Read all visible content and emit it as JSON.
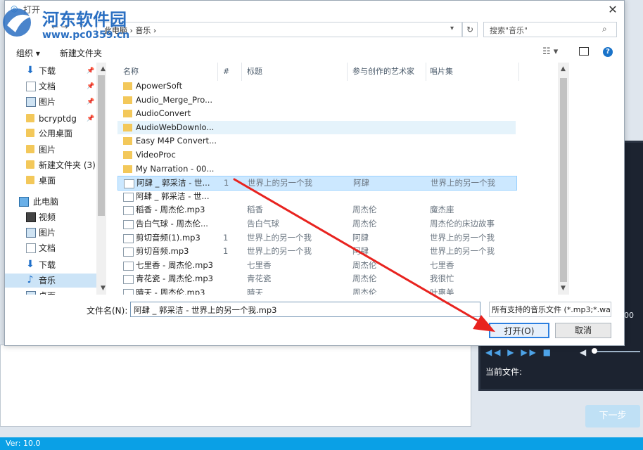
{
  "background": {
    "version": "Ver: 10.0",
    "next_button": "下一步",
    "current_file_label": "当前文件:",
    "time_fragment": "00"
  },
  "watermark": {
    "name": "河东软件园",
    "url": "www.pc0359.cn"
  },
  "dialog": {
    "title": "打开",
    "close": "✕",
    "breadcrumbs": "此电脑  ›  音乐  ›",
    "search_placeholder": "搜索\"音乐\"",
    "organize": "组织 ▾",
    "new_folder": "新建文件夹",
    "help": "?"
  },
  "nav": [
    {
      "label": "下载",
      "icon": "download-icon",
      "pinned": true
    },
    {
      "label": "文档",
      "icon": "document-icon",
      "pinned": true
    },
    {
      "label": "图片",
      "icon": "picture-icon",
      "pinned": true
    },
    {
      "label": "bcryptdg",
      "icon": "folder-icon",
      "pinned": true
    },
    {
      "label": "公用桌面",
      "icon": "folder-icon",
      "pinned": false
    },
    {
      "label": "图片",
      "icon": "folder-icon",
      "pinned": false
    },
    {
      "label": "新建文件夹 (3)",
      "icon": "folder-icon",
      "pinned": false
    },
    {
      "label": "桌面",
      "icon": "folder-icon",
      "pinned": false
    },
    {
      "label": "此电脑",
      "icon": "computer-icon",
      "pinned": false
    },
    {
      "label": "视频",
      "icon": "video-icon",
      "pinned": false
    },
    {
      "label": "图片",
      "icon": "picture-icon",
      "pinned": false
    },
    {
      "label": "文档",
      "icon": "document-icon",
      "pinned": false
    },
    {
      "label": "下载",
      "icon": "download-icon",
      "pinned": false
    },
    {
      "label": "音乐",
      "icon": "music-icon",
      "pinned": false,
      "selected": true
    },
    {
      "label": "桌面",
      "icon": "desktop-icon",
      "pinned": false
    }
  ],
  "columns": [
    "名称",
    "#",
    "标题",
    "参与创作的艺术家",
    "唱片集"
  ],
  "files": [
    {
      "name": "ApowerSoft",
      "type": "folder"
    },
    {
      "name": "Audio_Merge_Pro...",
      "type": "folder"
    },
    {
      "name": "AudioConvert",
      "type": "folder"
    },
    {
      "name": "AudioWebDownlo...",
      "type": "folder",
      "hover": true
    },
    {
      "name": "Easy M4P Convert...",
      "type": "folder"
    },
    {
      "name": "VideoProc",
      "type": "folder"
    },
    {
      "name": "My Narration - 00...",
      "type": "folder"
    },
    {
      "name": "阿肆 _ 郭采洁 - 世...",
      "type": "audio",
      "num": "1",
      "title": "世界上的另一个我",
      "artist": "阿肆",
      "album": "世界上的另一个我",
      "selected": true
    },
    {
      "name": "阿肆 _ 郭采洁 - 世...",
      "type": "audio"
    },
    {
      "name": "稻香 - 周杰伦.mp3",
      "type": "audio",
      "num": "",
      "title": "稻香",
      "artist": "周杰伦",
      "album": "魔杰座"
    },
    {
      "name": "告白气球 - 周杰伦...",
      "type": "audio",
      "num": "",
      "title": "告白气球",
      "artist": "周杰伦",
      "album": "周杰伦的床边故事"
    },
    {
      "name": "剪切音频(1).mp3",
      "type": "audio",
      "num": "1",
      "title": "世界上的另一个我",
      "artist": "阿肆",
      "album": "世界上的另一个我"
    },
    {
      "name": "剪切音频.mp3",
      "type": "audio",
      "num": "1",
      "title": "世界上的另一个我",
      "artist": "阿肆",
      "album": "世界上的另一个我"
    },
    {
      "name": "七里香 - 周杰伦.mp3",
      "type": "audio",
      "num": "",
      "title": "七里香",
      "artist": "周杰伦",
      "album": "七里香"
    },
    {
      "name": "青花瓷 - 周杰伦.mp3",
      "type": "audio",
      "num": "",
      "title": "青花瓷",
      "artist": "周杰伦",
      "album": "我很忙"
    },
    {
      "name": "晴天 - 周杰伦.mp3",
      "type": "audio",
      "num": "",
      "title": "晴天",
      "artist": "周杰伦",
      "album": "叶惠美"
    }
  ],
  "filename": {
    "label": "文件名(N):",
    "value": "阿肆 _ 郭采洁 - 世界上的另一个我.mp3",
    "type_filter": "所有支持的音乐文件 (*.mp3;*.wav"
  },
  "buttons": {
    "open": "打开(O)",
    "cancel": "取消"
  },
  "annotation_color": "#e8231f"
}
